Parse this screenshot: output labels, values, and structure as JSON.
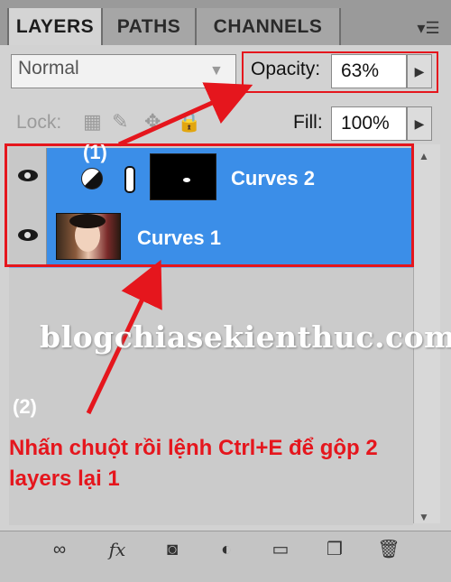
{
  "tabs": [
    "LAYERS",
    "PATHS",
    "CHANNELS"
  ],
  "panel_menu_icon": "panel-menu-icon",
  "blend_mode": "Normal",
  "opacity_label": "Opacity:",
  "opacity_value": "63%",
  "lock_label": "Lock:",
  "fill_label": "Fill:",
  "fill_value": "100%",
  "layers": [
    {
      "name": "Curves 2",
      "visible": true
    },
    {
      "name": "Curves 1",
      "visible": true
    }
  ],
  "annotations": {
    "step1": "(1)",
    "step2": "(2)",
    "watermark": "blogchiasekienthuc.com",
    "instruction": "Nhấn chuột rồi lệnh Ctrl+E để gộp 2 layers lại 1",
    "accent_color": "#e5161d"
  },
  "toolbar_icons": [
    "link-layers-icon",
    "fx-icon",
    "mask-icon",
    "adjustment-layer-icon",
    "folder-icon",
    "new-layer-icon",
    "trash-icon"
  ]
}
